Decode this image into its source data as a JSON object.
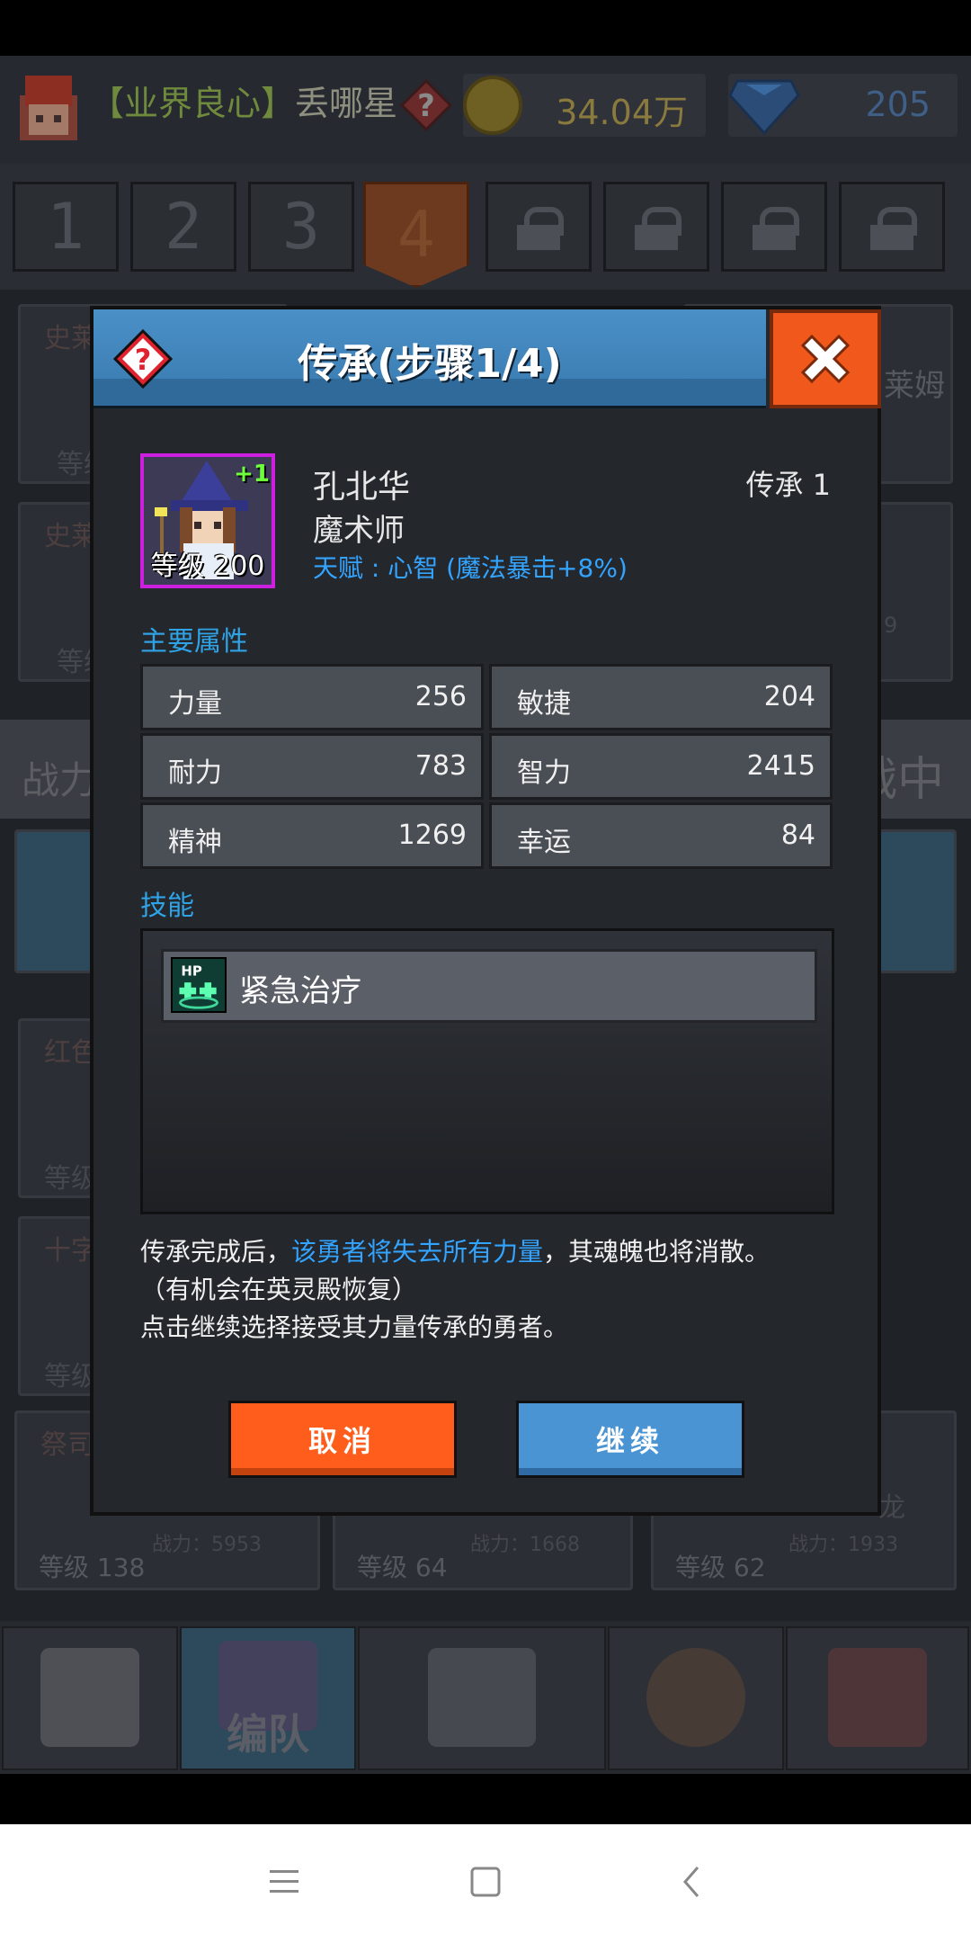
{
  "topbar": {
    "player_tag": "【业界良心】",
    "player_name": "丢哪星",
    "gold": "34.04万",
    "gems": "205"
  },
  "team_tabs": [
    "1",
    "2",
    "3",
    "4"
  ],
  "active_tab": "4",
  "locked_tabs": 4,
  "background": {
    "power_label": "战力",
    "mid_label": "战中",
    "cards": [
      {
        "class_label": "史莱",
        "level": "等级",
        "name_tail": "莱姆"
      },
      {
        "class_label": "史莱",
        "level": "等级",
        "power_tail": "9"
      },
      {
        "class_label": "红色",
        "level": "等级"
      },
      {
        "class_label": "十字",
        "level": "等级"
      },
      {
        "class_label": "祭司",
        "level": "等级 138",
        "power": "战力：5953"
      },
      {
        "level": "等级 64",
        "power": "战力：1668"
      },
      {
        "level": "等级 62",
        "power": "战力：1933",
        "name_tail": "龙"
      }
    ]
  },
  "bottom_nav": {
    "team_label": "编队"
  },
  "modal": {
    "title": "传承(步骤1/4)",
    "hero": {
      "name": "孔北华",
      "class": "魔术师",
      "talent": "天赋 : 心智 (魔法暴击+8%)",
      "level_badge": "等级 200",
      "plus": "+1",
      "inherit_count": "传承 1"
    },
    "attributes_label": "主要属性",
    "attributes": [
      {
        "name": "力量",
        "value": "256"
      },
      {
        "name": "敏捷",
        "value": "204"
      },
      {
        "name": "耐力",
        "value": "783"
      },
      {
        "name": "智力",
        "value": "2415"
      },
      {
        "name": "精神",
        "value": "1269"
      },
      {
        "name": "幸运",
        "value": "84"
      }
    ],
    "skills_label": "技能",
    "skills": [
      {
        "name": "紧急治疗",
        "icon": "heal-hp-icon"
      }
    ],
    "info": {
      "line1_a": "传承完成后，",
      "line1_hl": "该勇者将失去所有力量",
      "line1_b": "，其魂魄也将消散。",
      "line2": "（有机会在英灵殿恢复）",
      "line3": "点击继续选择接受其力量传承的勇者。"
    },
    "cancel_label": "取消",
    "continue_label": "继续"
  },
  "colors": {
    "accent_blue": "#33a4ff",
    "header_blue": "#4a90c7",
    "close_orange": "#f0581c",
    "portrait_border": "#cc1fe0"
  }
}
